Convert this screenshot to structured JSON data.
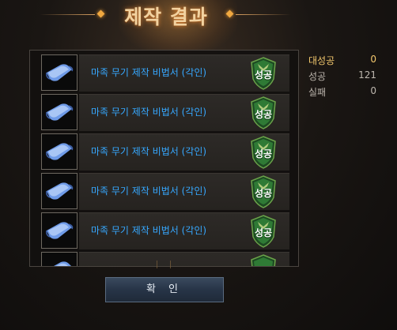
{
  "window": {
    "title": "제작 결과"
  },
  "results": [
    {
      "item_name": "마족 무기 제작 비법서 (각인)",
      "icon": "scroll-icon",
      "status": "성공"
    },
    {
      "item_name": "마족 무기 제작 비법서 (각인)",
      "icon": "scroll-icon",
      "status": "성공"
    },
    {
      "item_name": "마족 무기 제작 비법서 (각인)",
      "icon": "scroll-icon",
      "status": "성공"
    },
    {
      "item_name": "마족 무기 제작 비법서 (각인)",
      "icon": "scroll-icon",
      "status": "성공"
    },
    {
      "item_name": "마족 무기 제작 비법서 (각인)",
      "icon": "scroll-icon",
      "status": "성공"
    },
    {
      "item_name": "",
      "icon": "scroll-icon",
      "status": ""
    }
  ],
  "stats": [
    {
      "label": "대성공",
      "value": "0"
    },
    {
      "label": "성공",
      "value": "121"
    },
    {
      "label": "실패",
      "value": "0"
    }
  ],
  "confirm_label": "확 인",
  "colors": {
    "item_name": "#36a8ff",
    "great_success": "#f3c86d",
    "success_badge": "#2f7a35",
    "title": "#f2d2a0"
  }
}
